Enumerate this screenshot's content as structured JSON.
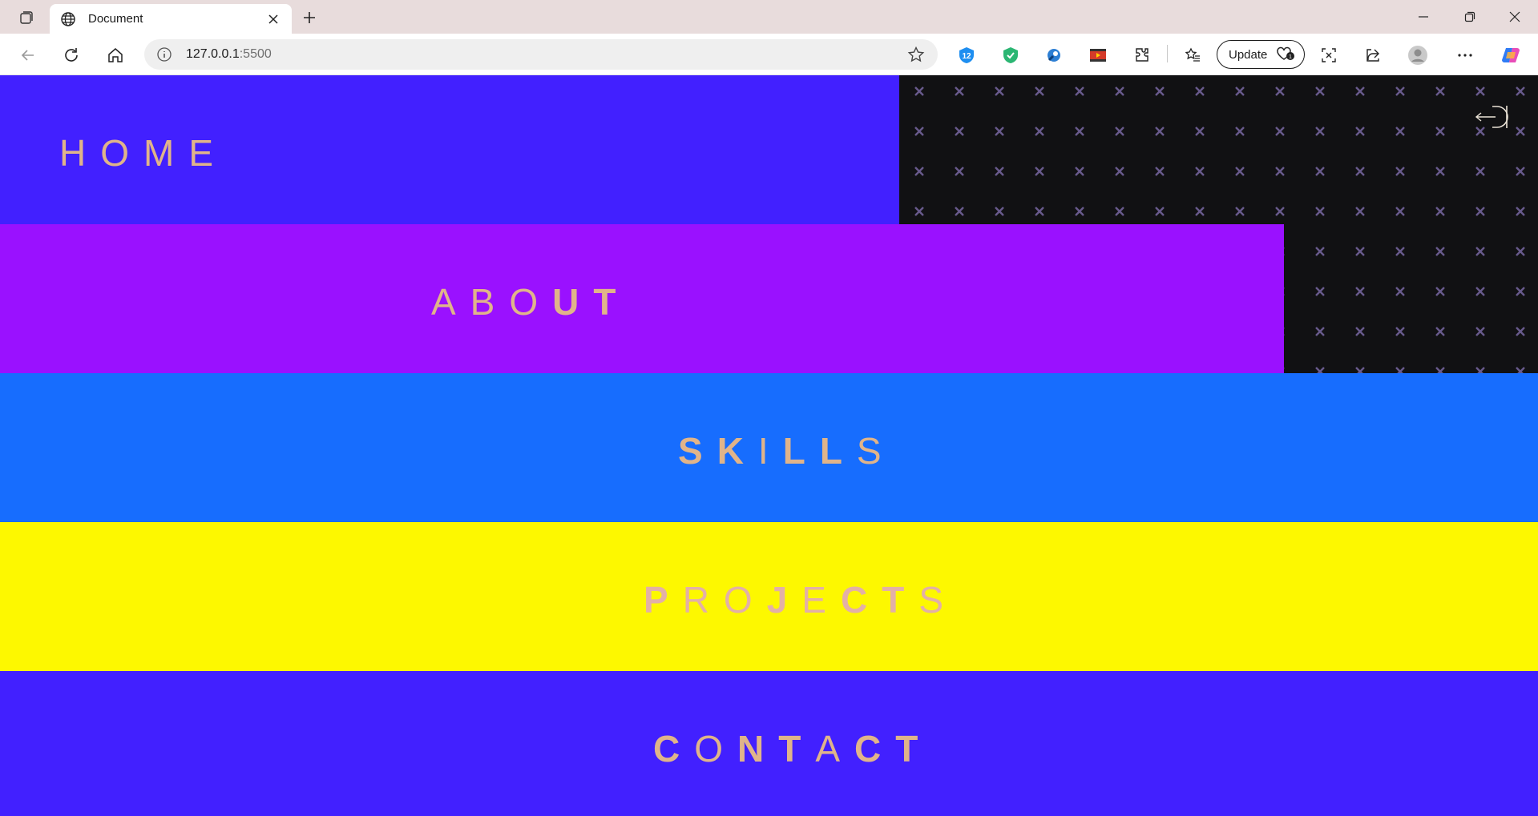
{
  "browser": {
    "tab_title": "Document",
    "url_host": "127.0.0.1",
    "url_port": ":5500",
    "update_label": "Update"
  },
  "nav": {
    "home": "HOME",
    "about_light": "ABO",
    "about_bold": "UT",
    "skills": [
      "S",
      "K",
      "I",
      "L",
      "L",
      "S"
    ],
    "projects": [
      "P",
      "R",
      "O",
      "J",
      "E",
      "C",
      "T",
      "S"
    ],
    "contact": [
      "C",
      "O",
      "N",
      "T",
      "A",
      "C",
      "T"
    ]
  },
  "colors": {
    "home_band": "#4220ff",
    "about_band": "#9a11ff",
    "skills_band": "#176dfe",
    "projects_band": "#fdf800",
    "contact_band": "#4220ff",
    "label_color": "#e0b48a",
    "pattern_bg": "#111113",
    "pattern_mark": "#685a8c"
  },
  "icons": [
    "tab-actions-icon",
    "globe-icon",
    "close-icon",
    "plus-icon",
    "minimize-icon",
    "restore-icon",
    "window-close-icon",
    "back-icon",
    "refresh-icon",
    "home-icon",
    "info-icon",
    "star-icon",
    "extension-icons",
    "favorites-icon",
    "screenshot-icon",
    "share-icon",
    "profile-icon",
    "more-icon",
    "copilot-icon",
    "menu-toggle-icon"
  ]
}
